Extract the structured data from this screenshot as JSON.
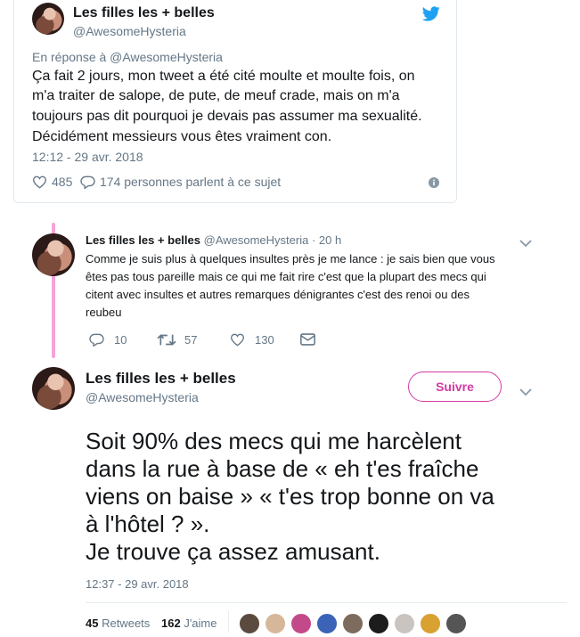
{
  "card": {
    "name": "Les filles les + belles",
    "handle": "@AwesomeHysteria",
    "reply_to": "En réponse à @AwesomeHysteria",
    "text_lines": [
      "Ça fait 2 jours, mon tweet a été cité moulte et moulte fois, on",
      "m'a traiter de salope, de pute, de meuf crade, mais on m'a",
      "toujours pas dit pourquoi je devais pas assumer ma sexualité.",
      "Décidément messieurs vous êtes vraiment con."
    ],
    "timestamp": "12:12 - 29 avr. 2018",
    "likes": "485",
    "replies_text": "174 personnes parlent à ce sujet"
  },
  "reply": {
    "name": "Les filles les + belles",
    "handle": "@AwesomeHysteria · 20 h",
    "text_lines": [
      "Comme je suis plus à quelques insultes près je me lance : je sais bien que vous",
      "êtes pas tous pareille mais ce qui me fait rire c'est que la plupart des mecs qui",
      "citent avec insultes et autres remarques dénigrantes c'est des renoi ou des",
      "reubeu"
    ],
    "replies": "10",
    "retweets": "57",
    "likes": "130"
  },
  "main": {
    "name": "Les filles les + belles",
    "handle": "@AwesomeHysteria",
    "follow_label": "Suivre",
    "text_lines": [
      "Soit 90% des mecs qui me harcèlent",
      "dans la rue à base de « eh t'es fraîche",
      "viens on baise » « t'es trop bonne on va",
      "à l'hôtel ? ».",
      "Je trouve ça assez amusant."
    ],
    "timestamp": "12:37 - 29 avr. 2018",
    "retweets_count": "45",
    "retweets_label": "Retweets",
    "likes_count": "162",
    "likes_label": "J'aime"
  },
  "colors": {
    "twitter_blue": "#1da1f2",
    "thread_pink": "#f5a3d9",
    "follow_accent": "#d33aa3",
    "muted": "#657786"
  }
}
